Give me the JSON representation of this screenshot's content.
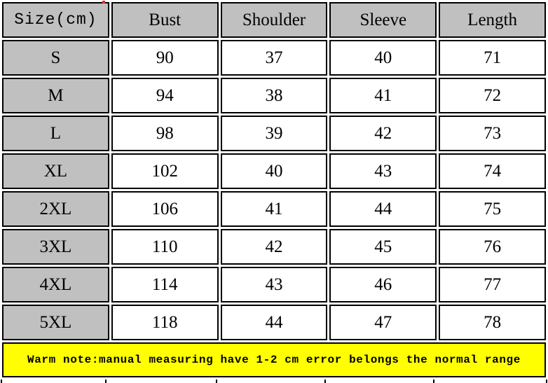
{
  "chart_data": {
    "type": "table",
    "title": "",
    "columns": [
      "Size(cm)",
      "Bust",
      "Shoulder",
      "Sleeve",
      "Length"
    ],
    "categories": [
      "S",
      "M",
      "L",
      "XL",
      "2XL",
      "3XL",
      "4XL",
      "5XL"
    ],
    "series": [
      {
        "name": "Bust",
        "values": [
          90,
          94,
          98,
          102,
          106,
          110,
          114,
          118
        ]
      },
      {
        "name": "Shoulder",
        "values": [
          37,
          38,
          39,
          40,
          41,
          42,
          43,
          44
        ]
      },
      {
        "name": "Sleeve",
        "values": [
          40,
          41,
          42,
          43,
          44,
          45,
          46,
          47
        ]
      },
      {
        "name": "Length",
        "values": [
          71,
          72,
          73,
          74,
          75,
          76,
          77,
          78
        ]
      }
    ],
    "rows": [
      [
        "S",
        "90",
        "37",
        "40",
        "71"
      ],
      [
        "M",
        "94",
        "38",
        "41",
        "72"
      ],
      [
        "L",
        "98",
        "39",
        "42",
        "73"
      ],
      [
        "XL",
        "102",
        "40",
        "43",
        "74"
      ],
      [
        "2XL",
        "106",
        "41",
        "44",
        "75"
      ],
      [
        "3XL",
        "110",
        "42",
        "45",
        "76"
      ],
      [
        "4XL",
        "114",
        "43",
        "46",
        "77"
      ],
      [
        "5XL",
        "118",
        "44",
        "47",
        "78"
      ]
    ],
    "xlabel": "",
    "ylabel": "",
    "grid": true,
    "legend": "none",
    "annotations": [
      "Warm note:manual measuring have 1-2 cm error belongs the normal range"
    ]
  },
  "table": {
    "headers": [
      {
        "label": "Size(cm)",
        "name": "header-size"
      },
      {
        "label": "Bust",
        "name": "header-bust"
      },
      {
        "label": "Shoulder",
        "name": "header-shoulder"
      },
      {
        "label": "Sleeve",
        "name": "header-sleeve"
      },
      {
        "label": "Length",
        "name": "header-length"
      }
    ],
    "rows": [
      {
        "size": "S",
        "bust": "90",
        "shoulder": "37",
        "sleeve": "40",
        "length": "71"
      },
      {
        "size": "M",
        "bust": "94",
        "shoulder": "38",
        "sleeve": "41",
        "length": "72"
      },
      {
        "size": "L",
        "bust": "98",
        "shoulder": "39",
        "sleeve": "42",
        "length": "73"
      },
      {
        "size": "XL",
        "bust": "102",
        "shoulder": "40",
        "sleeve": "43",
        "length": "74"
      },
      {
        "size": "2XL",
        "bust": "106",
        "shoulder": "41",
        "sleeve": "44",
        "length": "75"
      },
      {
        "size": "3XL",
        "bust": "110",
        "shoulder": "42",
        "sleeve": "45",
        "length": "76"
      },
      {
        "size": "4XL",
        "bust": "114",
        "shoulder": "43",
        "sleeve": "46",
        "length": "77"
      },
      {
        "size": "5XL",
        "bust": "118",
        "shoulder": "44",
        "sleeve": "47",
        "length": "78"
      }
    ]
  },
  "note": {
    "text": "Warm note:manual measuring have 1-2 cm error belongs the normal range"
  },
  "colors": {
    "header_background": "#c0c0c0",
    "size_column_background": "#c0c0c0",
    "cell_background": "#ffffff",
    "border": "#000000",
    "note_background": "#ffff00",
    "text": "#000000"
  }
}
